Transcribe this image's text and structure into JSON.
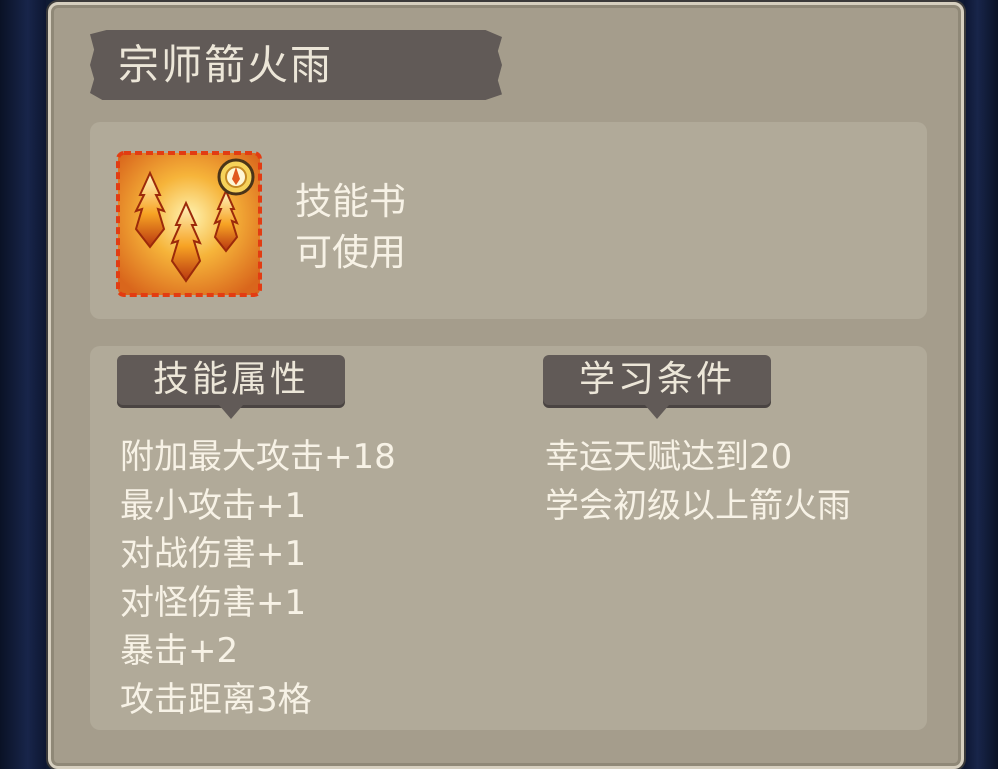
{
  "item": {
    "name": "宗师箭火雨",
    "type": "技能书",
    "usable": "可使用",
    "icon": "fire-arrow-rain-skill-icon"
  },
  "sections": {
    "attributes": {
      "title": "技能属性",
      "lines": [
        "附加最大攻击+18",
        "最小攻击+1",
        "对战伤害+1",
        "对怪伤害+1",
        "暴击+2",
        "攻击距离3格"
      ]
    },
    "requirements": {
      "title": "学习条件",
      "lines": [
        "幸运天赋达到20",
        "学会初级以上箭火雨"
      ]
    }
  },
  "colors": {
    "panel": "#a59d8c",
    "inner_box": "#b1aa99",
    "banner": "#615a57",
    "text": "#f7f2e6",
    "frame": "#0f1a33"
  }
}
